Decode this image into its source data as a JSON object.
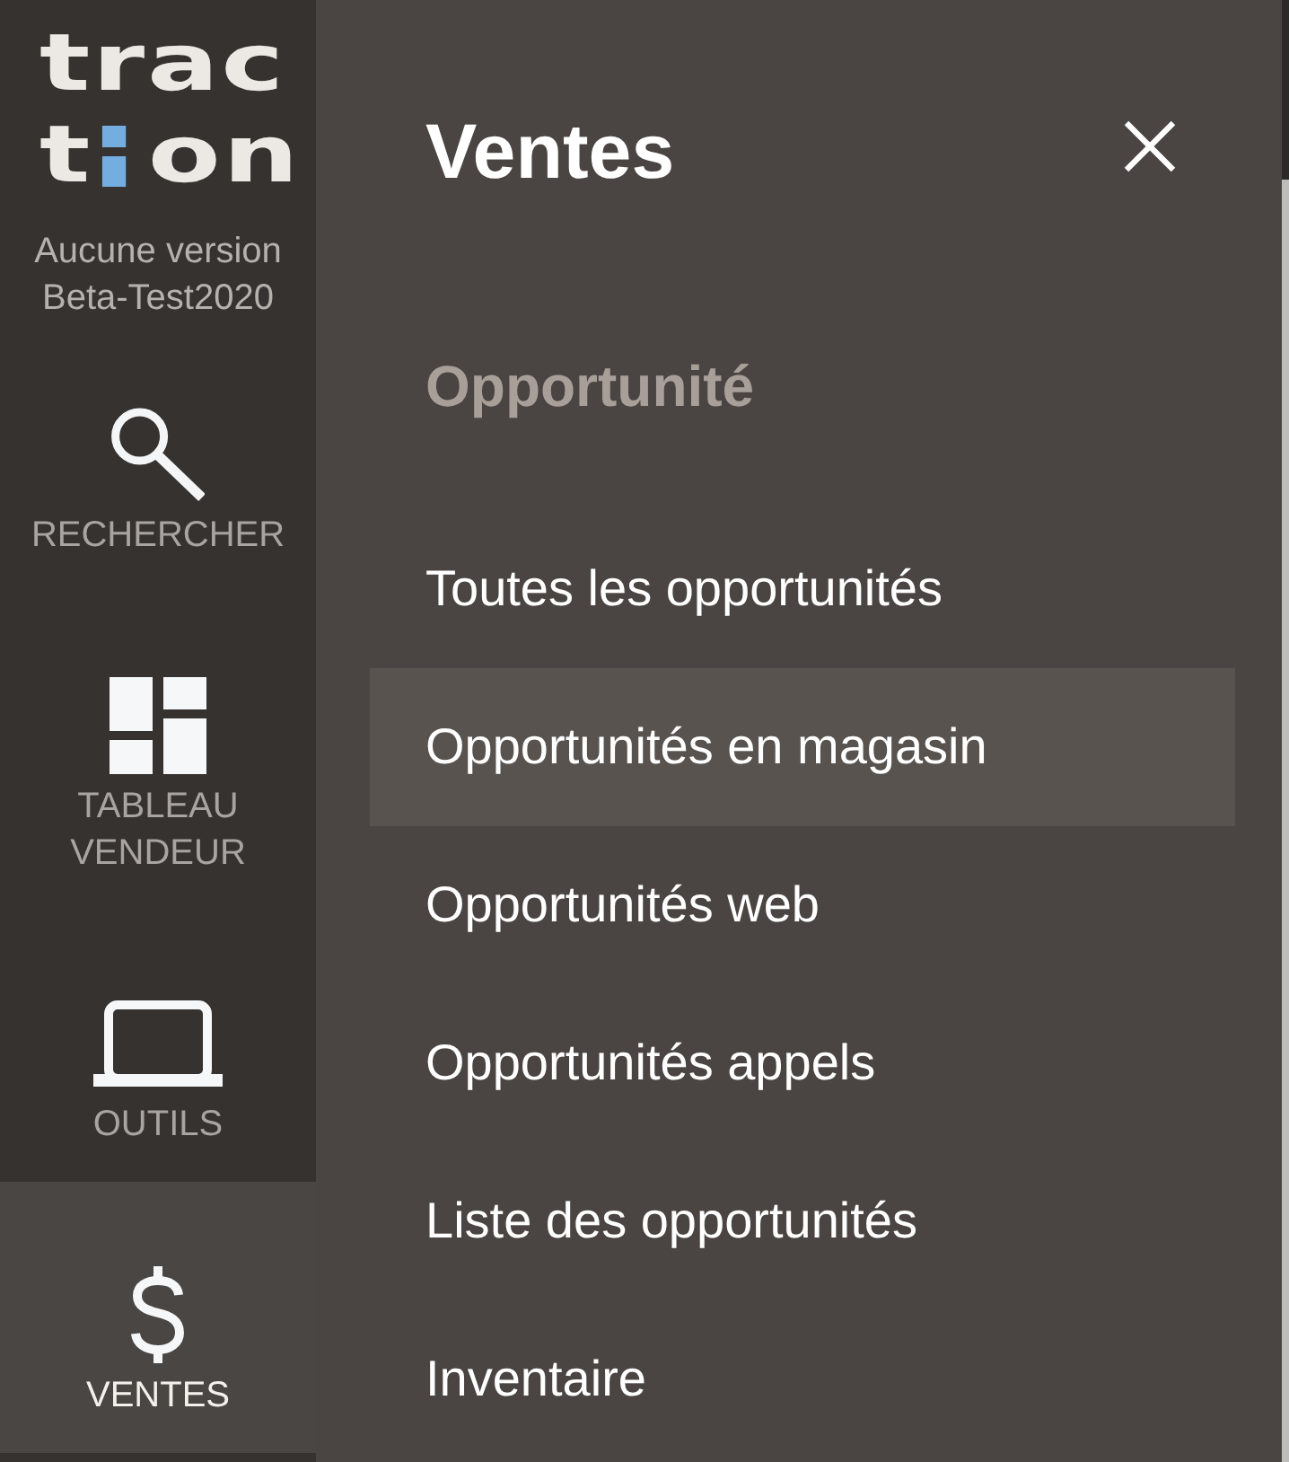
{
  "logo": {
    "line_1": "trac",
    "line_2_start": "t",
    "line_2_end": "on"
  },
  "version_label": "Aucune version",
  "version_name": "Beta-Test2020",
  "sidebar": {
    "items": [
      {
        "kind": "search",
        "label": "RECHERCHER",
        "selected": false
      },
      {
        "kind": "dashboard",
        "label": "TABLEAU VENDEUR",
        "selected": false
      },
      {
        "kind": "laptop",
        "label": "OUTILS",
        "selected": false
      },
      {
        "kind": "dollar",
        "label": "VENTES",
        "selected": true
      }
    ]
  },
  "panel": {
    "title": "Ventes",
    "section": "Opportunité",
    "items": [
      {
        "label": "Toutes les opportunités",
        "selected": false
      },
      {
        "label": "Opportunités en magasin",
        "selected": true
      },
      {
        "label": "Opportunités web",
        "selected": false
      },
      {
        "label": "Opportunités appels",
        "selected": false
      },
      {
        "label": "Liste des opportunités",
        "selected": false
      },
      {
        "label": "Inventaire",
        "selected": false
      }
    ]
  }
}
